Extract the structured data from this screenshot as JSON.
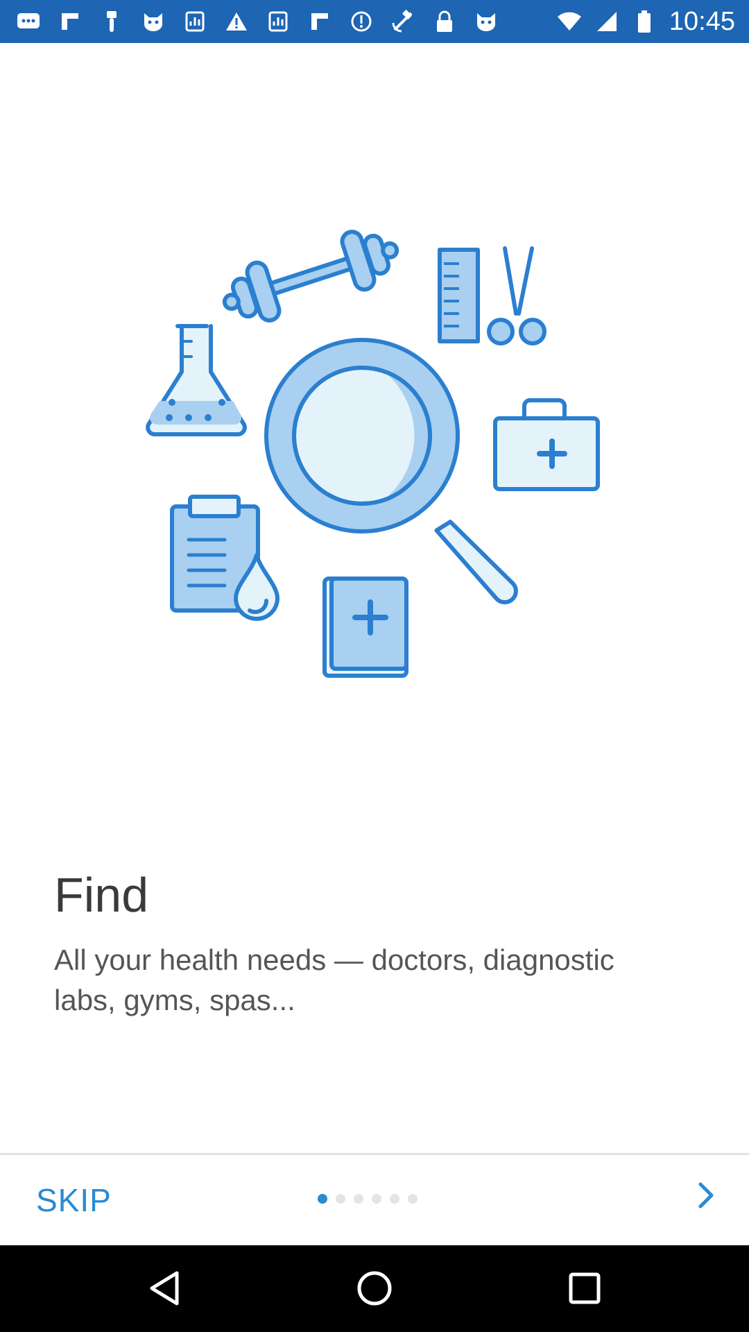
{
  "status_bar": {
    "time": "10:45",
    "left_icons": [
      "messages-icon",
      "flipboard-icon",
      "paint-icon",
      "cat-icon",
      "chart-app-icon",
      "warning-icon",
      "chart-app-icon",
      "flipboard-icon",
      "sync-icon",
      "fake-gps-icon",
      "lock-icon",
      "cat-icon"
    ]
  },
  "onboarding": {
    "title": "Find",
    "subtitle": "All your health needs — doctors, diagnostic labs, gyms, spas..."
  },
  "footer": {
    "skip_label": "SKIP",
    "page_count": 6,
    "current_page": 1
  },
  "colors": {
    "accent": "#2b8ad2",
    "status_bar": "#1e65b3",
    "illustration_stroke": "#2b7fd0",
    "illustration_fill": "#a9d0f0",
    "illustration_light": "#e4f3fa"
  }
}
